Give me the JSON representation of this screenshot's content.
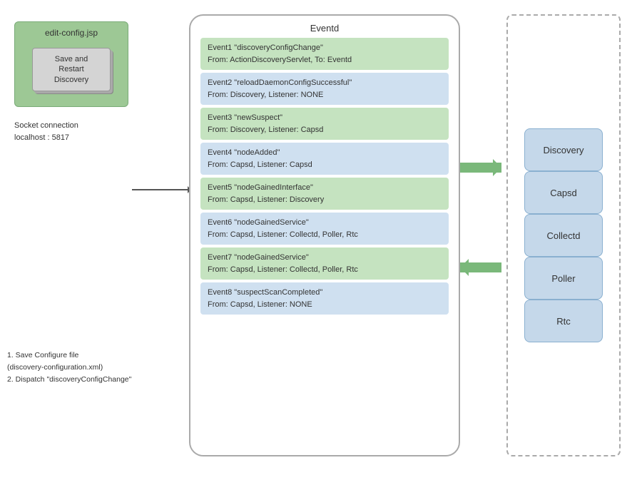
{
  "editConfig": {
    "title": "edit-config.jsp",
    "saveBtn": "Save and Restart Discovery"
  },
  "socket": {
    "line1": "Socket connection",
    "line2": "localhost : 5817"
  },
  "steps": {
    "line1": "1. Save Configure file",
    "line2": "(discovery-configuration.xml)",
    "line3": "2. Dispatch \"discoveryConfigChange\""
  },
  "eventd": {
    "title": "Eventd",
    "events": [
      {
        "id": "event1",
        "line1": "Event1 \"discoveryConfigChange\"",
        "line2": "From: ActionDiscoveryServlet, To: Eventd",
        "color": "green"
      },
      {
        "id": "event2",
        "line1": "Event2 \"reloadDaemonConfigSuccessful\"",
        "line2": "From: Discovery, Listener: NONE",
        "color": "blue"
      },
      {
        "id": "event3",
        "line1": "Event3 \"newSuspect\"",
        "line2": "From: Discovery, Listener: Capsd",
        "color": "green"
      },
      {
        "id": "event4",
        "line1": "Event4 \"nodeAdded\"",
        "line2": "From: Capsd, Listener: Capsd",
        "color": "blue"
      },
      {
        "id": "event5",
        "line1": "Event5 \"nodeGainedInterface\"",
        "line2": "From: Capsd, Listener: Discovery",
        "color": "green"
      },
      {
        "id": "event6",
        "line1": "Event6 \"nodeGainedService\"",
        "line2": "From: Capsd, Listener: Collectd, Poller, Rtc",
        "color": "blue"
      },
      {
        "id": "event7",
        "line1": "Event7 \"nodeGainedService\"",
        "line2": "From: Capsd, Listener: Collectd, Poller, Rtc",
        "color": "green"
      },
      {
        "id": "event8",
        "line1": "Event8 \"suspectScanCompleted\"",
        "line2": "From: Capsd, Listener: NONE",
        "color": "blue"
      }
    ]
  },
  "services": {
    "items": [
      "Discovery",
      "Capsd",
      "Collectd",
      "Poller",
      "Rtc"
    ]
  }
}
